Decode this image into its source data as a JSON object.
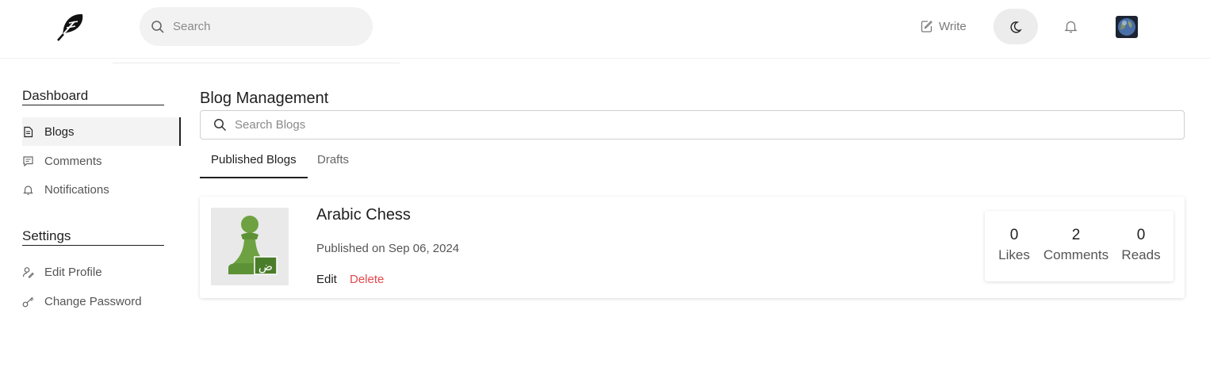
{
  "header": {
    "search_placeholder": "Search",
    "write_label": "Write"
  },
  "sidebar": {
    "dashboard_heading": "Dashboard",
    "items": [
      {
        "label": "Blogs",
        "icon": "document-icon"
      },
      {
        "label": "Comments",
        "icon": "comment-icon"
      },
      {
        "label": "Notifications",
        "icon": "bell-icon"
      }
    ],
    "settings_heading": "Settings",
    "settings_items": [
      {
        "label": "Edit Profile",
        "icon": "edit-profile-icon"
      },
      {
        "label": "Change Password",
        "icon": "key-icon"
      }
    ]
  },
  "main": {
    "title": "Blog Management",
    "search_placeholder": "Search Blogs",
    "tabs": [
      {
        "label": "Published Blogs",
        "active": true
      },
      {
        "label": "Drafts",
        "active": false
      }
    ],
    "blogs": [
      {
        "title": "Arabic Chess",
        "published": "Published on Sep 06, 2024",
        "edit_label": "Edit",
        "delete_label": "Delete",
        "thumb_letter": "ض",
        "stats": [
          {
            "value": "0",
            "label": "Likes"
          },
          {
            "value": "2",
            "label": "Comments"
          },
          {
            "value": "0",
            "label": "Reads"
          }
        ]
      }
    ]
  },
  "colors": {
    "accent": "#1f1f1f",
    "delete": "#e5484d",
    "pawn_green": "#5d9136"
  }
}
